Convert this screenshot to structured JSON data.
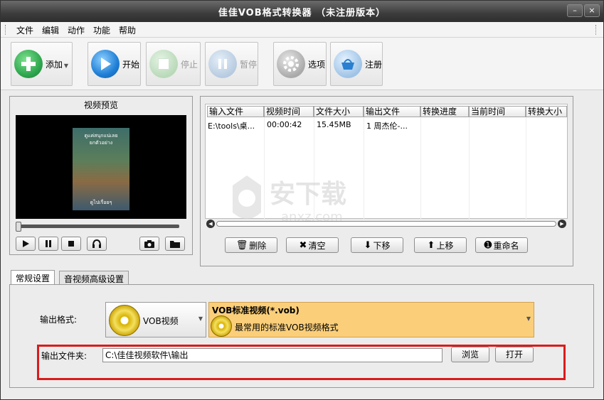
{
  "window": {
    "title": "佳佳VOB格式转换器  （未注册版本）",
    "controls": {
      "minimize": "–",
      "close": "×"
    }
  },
  "menu": [
    "文件",
    "编辑",
    "动作",
    "功能",
    "帮助"
  ],
  "toolbar": {
    "add": "添加",
    "start": "开始",
    "stop": "停止",
    "pause": "暂停",
    "options": "选项",
    "register": "注册"
  },
  "preview": {
    "title": "视频预览",
    "video_lines": [
      "ดูแค่สนุกแน่เลย",
      "ยกตัวอย่าง",
      "ดูไปเรื่อยๆ"
    ]
  },
  "file_list": {
    "columns": [
      "输入文件",
      "视频时间",
      "文件大小",
      "输出文件",
      "转换进度",
      "当前时间",
      "转换大小"
    ],
    "rows": [
      [
        "E:\\tools\\桌...",
        "00:00:42",
        "15.45MB",
        "1 周杰伦-...",
        "",
        "",
        ""
      ]
    ]
  },
  "list_actions": {
    "delete": "删除",
    "clear": "清空",
    "move_down": "下移",
    "move_up": "上移",
    "rename": "重命名"
  },
  "tabs": [
    "常规设置",
    "音视频高级设置"
  ],
  "settings": {
    "output_format_label": "输出格式:",
    "format_name": "VOB视频",
    "format_title": "VOB标准视频(*.vob)",
    "format_desc": "最常用的标准VOB视频格式",
    "output_folder_label": "输出文件夹:",
    "output_folder_value": "C:\\佳佳视频软件\\输出",
    "browse": "浏览",
    "open": "打开"
  },
  "watermark": {
    "brand": "安下载",
    "domain": "anxz.com"
  },
  "colors": {
    "accent_green": "#2fa84f",
    "accent_blue": "#1f7fd6",
    "highlight_red": "#d91c1c",
    "format_bg": "#fbcf7a"
  }
}
